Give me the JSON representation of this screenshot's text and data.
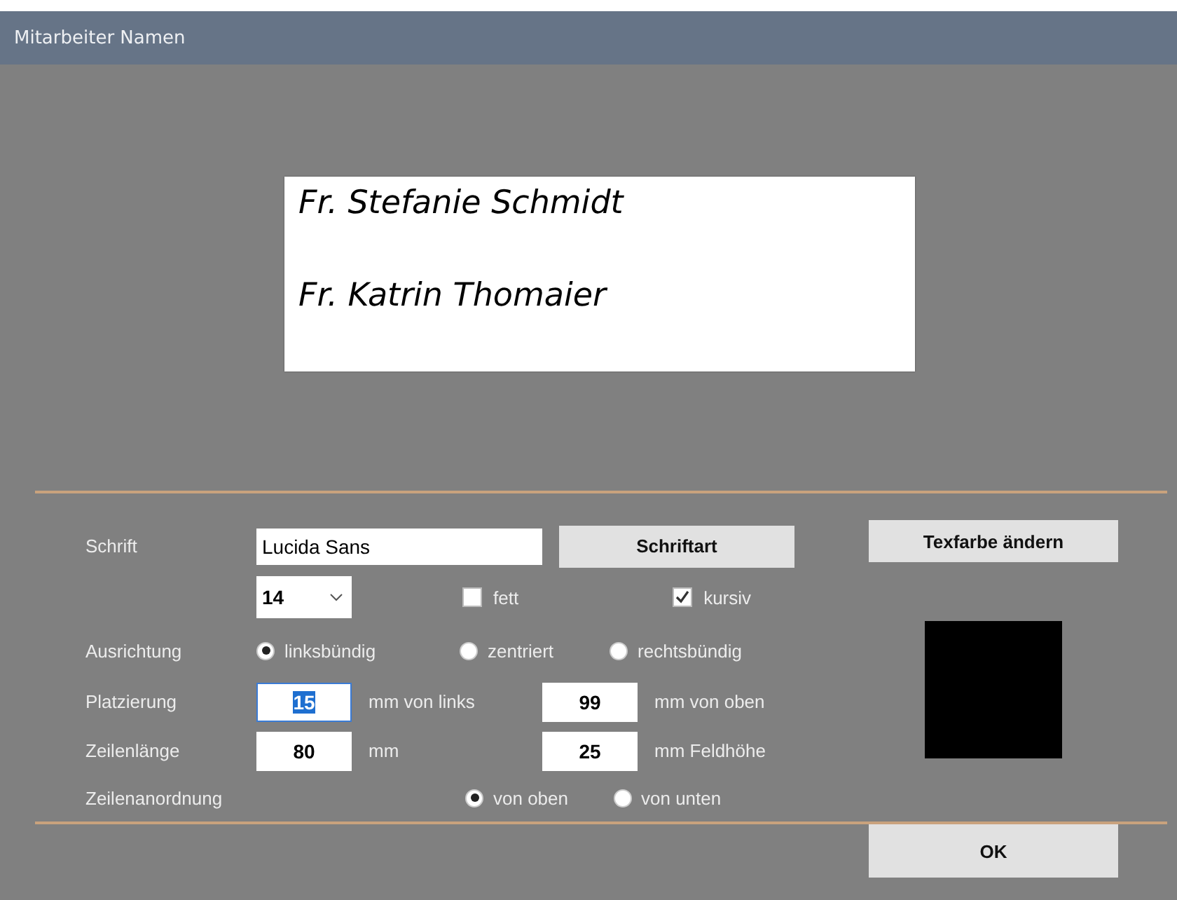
{
  "window": {
    "title": "Mitarbeiter Namen"
  },
  "preview": {
    "lines": [
      "Fr. Stefanie Schmidt",
      "Fr. Katrin Thomaier"
    ]
  },
  "font": {
    "label": "Schrift",
    "value": "Lucida Sans",
    "button": "Schriftart",
    "size": "14"
  },
  "color_button": "Texfarbe ändern",
  "styles": [
    {
      "label": "fett",
      "checked": false
    },
    {
      "label": "kursiv",
      "checked": true
    }
  ],
  "alignment": {
    "label": "Ausrichtung",
    "options": [
      {
        "label": "linksbündig",
        "selected": true
      },
      {
        "label": "zentriert",
        "selected": false
      },
      {
        "label": "rechtsbündig",
        "selected": false
      }
    ]
  },
  "placement": {
    "label": "Platzierung",
    "left": {
      "value": "15",
      "unit": "mm von links",
      "focused": true
    },
    "top": {
      "value": "99",
      "unit": "mm von oben",
      "focused": false
    }
  },
  "line_length": {
    "label": "Zeilenlänge",
    "length": {
      "value": "80",
      "unit": "mm",
      "focused": false
    },
    "height": {
      "value": "25",
      "unit": "mm Feldhöhe",
      "focused": false
    }
  },
  "line_order": {
    "label": "Zeilenanordnung",
    "options": [
      {
        "label": "von oben",
        "selected": true
      },
      {
        "label": "von unten",
        "selected": false
      }
    ]
  },
  "ok_button": "OK"
}
